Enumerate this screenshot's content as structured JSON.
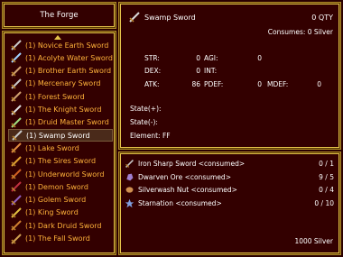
{
  "title_window": {
    "title": "The Forge"
  },
  "recipes": [
    {
      "label": "(1) Novice Earth Sword",
      "icon": "sword-icon",
      "color": "#c8c8c8"
    },
    {
      "label": "(1) Acolyte Water Sword",
      "icon": "sword-icon",
      "color": "#9fd0ff"
    },
    {
      "label": "(1) Brother Earth Sword",
      "icon": "sword-icon",
      "color": "#d0a070"
    },
    {
      "label": "(1) Mercenary Sword",
      "icon": "sword-icon",
      "color": "#c8c8c8"
    },
    {
      "label": "(1) Forest Sword",
      "icon": "sword-icon",
      "color": "#d0a070"
    },
    {
      "label": "(1) The Knight Sword",
      "icon": "sword-icon",
      "color": "#e0e0e0"
    },
    {
      "label": "(1) Druid Master Sword",
      "icon": "sword-icon",
      "color": "#a0e080"
    },
    {
      "label": "(1) Swamp Sword",
      "icon": "sword-icon",
      "color": "#c8c8c8",
      "selected": true
    },
    {
      "label": "(1) Lake Sword",
      "icon": "sword-icon",
      "color": "#e08a40"
    },
    {
      "label": "(1) The Sires Sword",
      "icon": "sword-icon",
      "color": "#e0a030"
    },
    {
      "label": "(1) Underworld Sword",
      "icon": "sword-icon",
      "color": "#d06020"
    },
    {
      "label": "(1) Demon Sword",
      "icon": "sword-icon",
      "color": "#c03040"
    },
    {
      "label": "(1) Golem Sword",
      "icon": "sword-icon",
      "color": "#9060c0"
    },
    {
      "label": "(1) King Sword",
      "icon": "sword-icon",
      "color": "#e0c040"
    },
    {
      "label": "(1) Dark Druid Sword",
      "icon": "sword-icon",
      "color": "#d08030"
    },
    {
      "label": "(1) The Fall Sword",
      "icon": "sword-icon",
      "color": "#d0a050"
    }
  ],
  "detail": {
    "item_name": "Swamp Sword",
    "qty": "0 QTY",
    "consumes": "Consumes: 0 Silver",
    "str_label": "STR:",
    "str_value": "0",
    "agi_label": "AGI:",
    "agi_value": "0",
    "dex_label": "DEX:",
    "dex_value": "0",
    "int_label": "INT:",
    "atk_label": "ATK:",
    "atk_value": "86",
    "pdef_label": "PDEF:",
    "pdef_value": "0",
    "mdef_label": "MDEF:",
    "mdef_value": "0",
    "state_plus": "State(+):",
    "state_minus": "State(-):",
    "element": "Element: FF"
  },
  "requirements": [
    {
      "label": "Iron Sharp Sword   <consumed>",
      "count": "0 / 1",
      "icon": "sword-icon",
      "color": "#c8c8c8"
    },
    {
      "label": "Dwarven Ore   <consumed>",
      "count": "9 / 5",
      "icon": "ore-icon",
      "color": "#a080d0"
    },
    {
      "label": "Silverwash Nut   <consumed>",
      "count": "0 / 4",
      "icon": "nut-icon",
      "color": "#d09050"
    },
    {
      "label": "Starnation   <consumed>",
      "count": "0 / 10",
      "icon": "star-icon",
      "color": "#80a0e0"
    }
  ],
  "silver_total": "1000 Silver"
}
